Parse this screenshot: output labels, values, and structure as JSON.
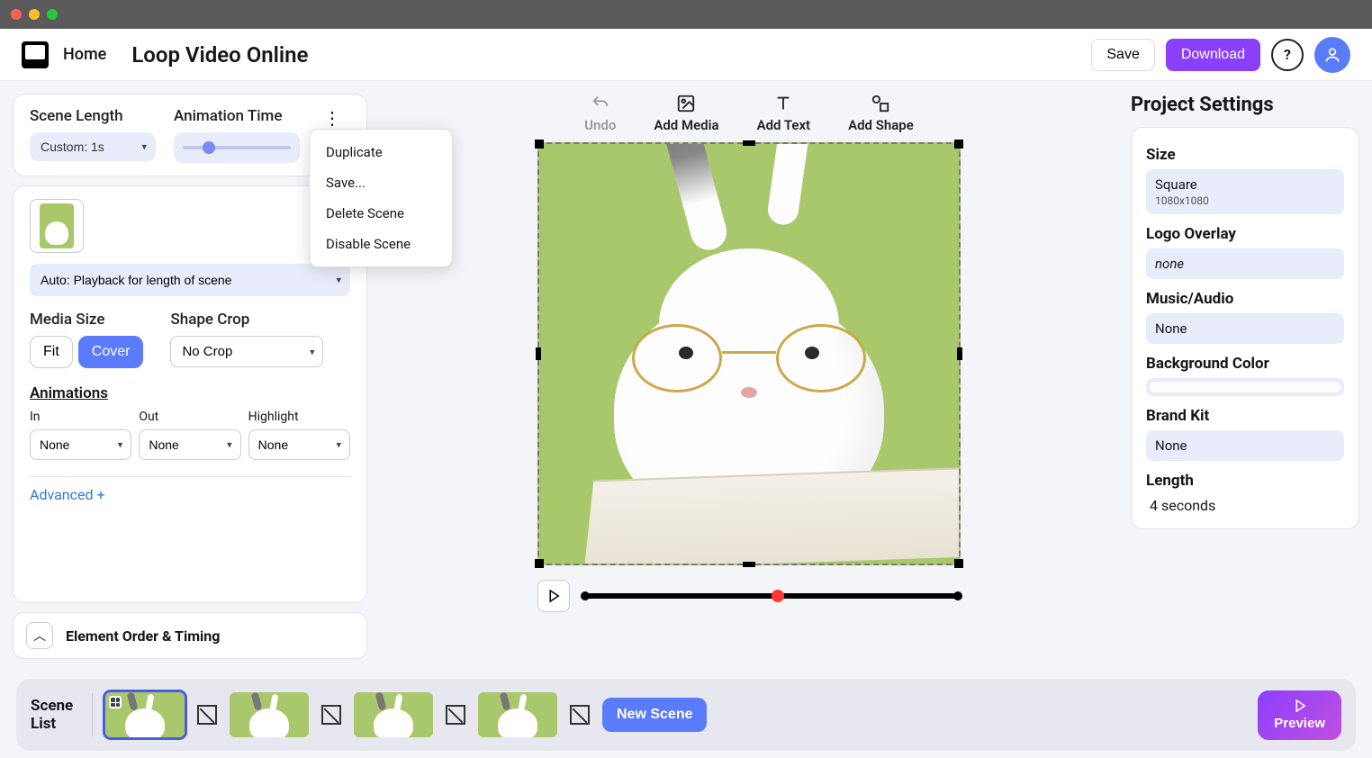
{
  "topbar": {
    "home": "Home",
    "title": "Loop Video Online",
    "save": "Save",
    "download": "Download"
  },
  "scene_top": {
    "scene_length_label": "Scene Length",
    "scene_length_value": "Custom: 1s",
    "animation_time_label": "Animation Time"
  },
  "context_menu": {
    "duplicate": "Duplicate",
    "save": "Save...",
    "delete": "Delete Scene",
    "disable": "Disable Scene"
  },
  "media": {
    "playback_value": "Auto: Playback for length of scene",
    "media_size_label": "Media Size",
    "fit": "Fit",
    "cover": "Cover",
    "shape_crop_label": "Shape Crop",
    "shape_crop_value": "No Crop",
    "animations_label": "Animations",
    "in_label": "In",
    "out_label": "Out",
    "highlight_label": "Highlight",
    "none": "None",
    "advanced": "Advanced +"
  },
  "order_bar": "Element Order & Timing",
  "tools": {
    "undo": "Undo",
    "add_media": "Add Media",
    "add_text": "Add Text",
    "add_shape": "Add Shape"
  },
  "project_settings": {
    "title": "Project Settings",
    "size_label": "Size",
    "size_value": "Square",
    "size_sub": "1080x1080",
    "logo_label": "Logo Overlay",
    "logo_value": "none",
    "music_label": "Music/Audio",
    "music_value": "None",
    "bg_label": "Background Color",
    "brand_label": "Brand Kit",
    "brand_value": "None",
    "length_label": "Length",
    "length_value": "4 seconds"
  },
  "footer": {
    "scene_list": "Scene List",
    "new_scene": "New Scene",
    "preview": "Preview"
  }
}
